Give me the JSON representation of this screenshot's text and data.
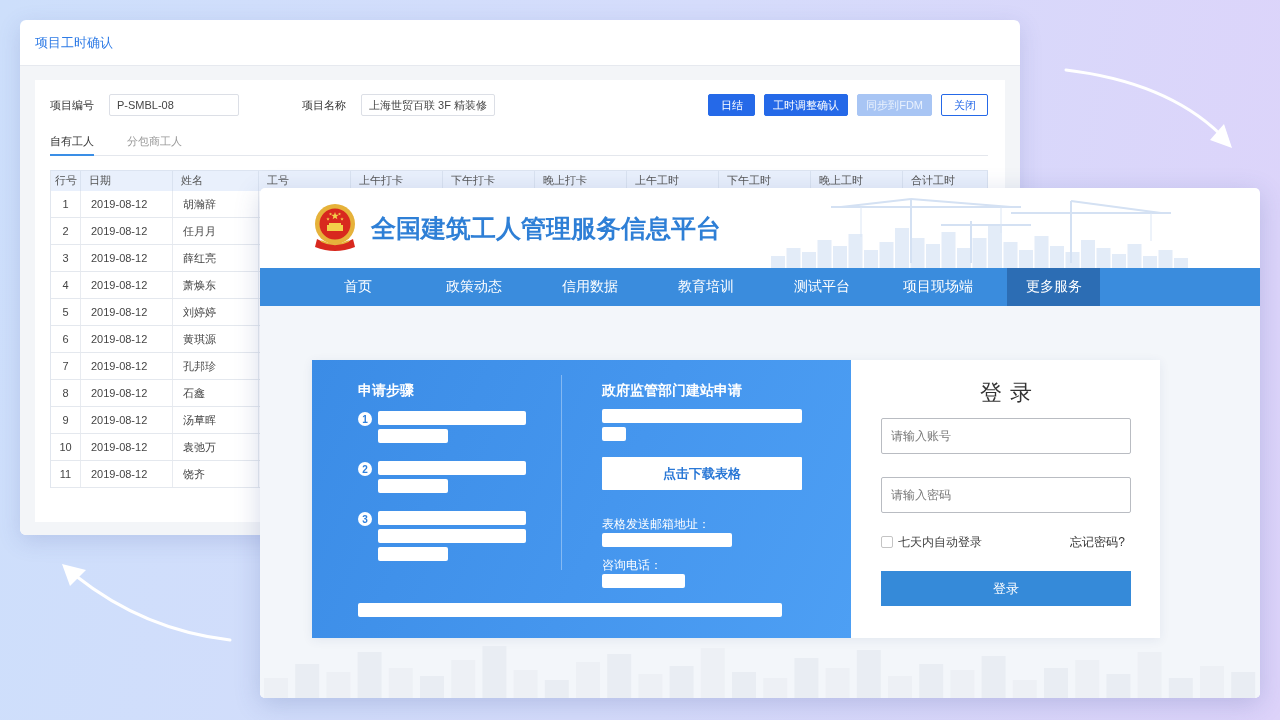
{
  "back_window": {
    "title": "项目工时确认",
    "form": [
      {
        "label": "项目编号",
        "value": "P-SMBL-08"
      },
      {
        "label": "项目名称",
        "value": "上海世贸百联 3F 精装修"
      }
    ],
    "buttons": [
      {
        "label": "日结",
        "kind": "primary",
        "disabled": false
      },
      {
        "label": "工时调整确认",
        "kind": "primary",
        "disabled": false
      },
      {
        "label": "同步到FDM",
        "kind": "primary",
        "disabled": true
      },
      {
        "label": "关闭",
        "kind": "outline",
        "disabled": false
      }
    ],
    "tabs": [
      {
        "label": "自有工人",
        "selected": true
      },
      {
        "label": "分包商工人",
        "selected": false
      }
    ],
    "table": {
      "columns": [
        "行号",
        "日期",
        "姓名",
        "工号",
        "上午打卡",
        "下午打卡",
        "晚上打卡",
        "上午工时",
        "下午工时",
        "晚上工时",
        "合计工时"
      ],
      "rows": [
        [
          "1",
          "2019-08-12",
          "胡瀚辞"
        ],
        [
          "2",
          "2019-08-12",
          "任月月"
        ],
        [
          "3",
          "2019-08-12",
          "薛红亮"
        ],
        [
          "4",
          "2019-08-12",
          "萧焕东"
        ],
        [
          "5",
          "2019-08-12",
          "刘婷婷"
        ],
        [
          "6",
          "2019-08-12",
          "黄琪源"
        ],
        [
          "7",
          "2019-08-12",
          "孔邦珍"
        ],
        [
          "8",
          "2019-08-12",
          "石鑫"
        ],
        [
          "9",
          "2019-08-12",
          "汤草晖"
        ],
        [
          "10",
          "2019-08-12",
          "袁弛万"
        ],
        [
          "11",
          "2019-08-12",
          "饶齐"
        ]
      ]
    }
  },
  "front_window": {
    "site_title": "全国建筑工人管理服务信息平台",
    "nav": [
      {
        "label": "首页",
        "selected": false
      },
      {
        "label": "政策动态",
        "selected": false
      },
      {
        "label": "信用数据",
        "selected": false
      },
      {
        "label": "教育培训",
        "selected": false
      },
      {
        "label": "测试平台",
        "selected": false
      },
      {
        "label": "项目现场端",
        "selected": false
      },
      {
        "label": "更多服务",
        "selected": true
      }
    ],
    "apply_panel": {
      "steps_title": "申请步骤",
      "steps": [
        {
          "number": "1",
          "lines": [
            {
              "kind": "long"
            },
            {
              "kind": "short"
            }
          ]
        },
        {
          "number": "2",
          "lines": [
            {
              "kind": "long"
            },
            {
              "kind": "short"
            }
          ]
        },
        {
          "number": "3",
          "lines": [
            {
              "kind": "long"
            },
            {
              "kind": "long"
            },
            {
              "kind": "short"
            }
          ]
        }
      ],
      "site_title": "政府监管部门建站申请",
      "site_lines": [
        {
          "kind": "wide"
        },
        {
          "kind": "tiny"
        }
      ],
      "download_button": "点击下载表格",
      "contacts": [
        {
          "label": "表格发送邮箱地址：",
          "line": {
            "kind": "medium"
          }
        },
        {
          "label": "咨询电话：",
          "line": {
            "kind": "compact"
          }
        }
      ],
      "footer_line": {
        "kind": "full"
      }
    },
    "login": {
      "title": "登录",
      "fields": [
        {
          "placeholder": "请输入账号"
        },
        {
          "placeholder": "请输入密码"
        }
      ],
      "remember": {
        "label": "七天内自动登录",
        "checked": false
      },
      "forgot_link": "忘记密码?",
      "submit": "登录"
    }
  }
}
